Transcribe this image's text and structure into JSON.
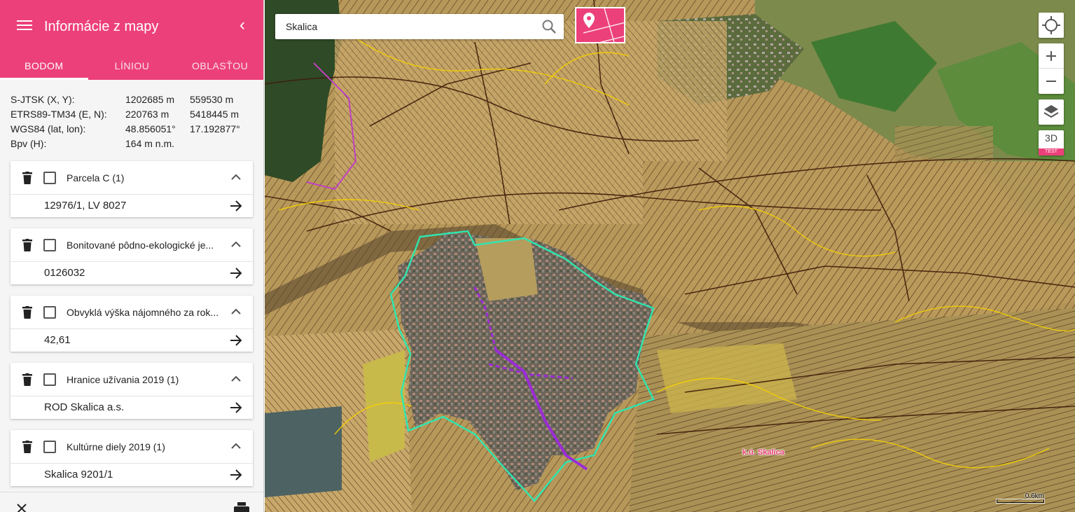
{
  "sidebar": {
    "title": "Informácie z mapy",
    "menu_icon": "menu-icon",
    "collapse_icon": "chevron-left-icon",
    "collapse_symbol": "‹",
    "tabs": [
      {
        "label": "BODOM",
        "active": true
      },
      {
        "label": "LÍNIOU",
        "active": false
      },
      {
        "label": "OBLASŤOU",
        "active": false
      }
    ],
    "coordinates": [
      {
        "label": "S-JTSK (X, Y):",
        "v1": "1202685 m",
        "v2": "559530 m"
      },
      {
        "label": "ETRS89-TM34 (E, N):",
        "v1": "220763 m",
        "v2": "5418445 m"
      },
      {
        "label": "WGS84 (lat, lon):",
        "v1": "48.856051°",
        "v2": "17.192877°"
      },
      {
        "label": "Bpv (H):",
        "v1": "164 m n.m.",
        "v2": ""
      }
    ],
    "results": [
      {
        "title": "Parcela C (1)",
        "value": "12976/1, LV 8027"
      },
      {
        "title": "Bonitované pôdno-ekologické je...",
        "value": "0126032"
      },
      {
        "title": "Obvyklá výška nájomného za rok...",
        "value": "42,61"
      },
      {
        "title": "Hranice užívania 2019 (1)",
        "value": "ROD Skalica a.s."
      },
      {
        "title": "Kultúrne diely 2019 (1)",
        "value": "Skalica 9201/1"
      }
    ]
  },
  "map": {
    "search": {
      "value": "Skalica"
    },
    "controls": {
      "three_d_label": "3D",
      "test_badge": "TEST"
    },
    "territory_label": "k.ú. Skalica",
    "scale_label": "0.6km"
  },
  "colors": {
    "accent": "#ec407a",
    "parcel_lines": "#5a2a14",
    "usage_boundary": "#f5d000",
    "district_boundary": "#2ee6b0",
    "selected_parcel": "#9b2cd6"
  }
}
